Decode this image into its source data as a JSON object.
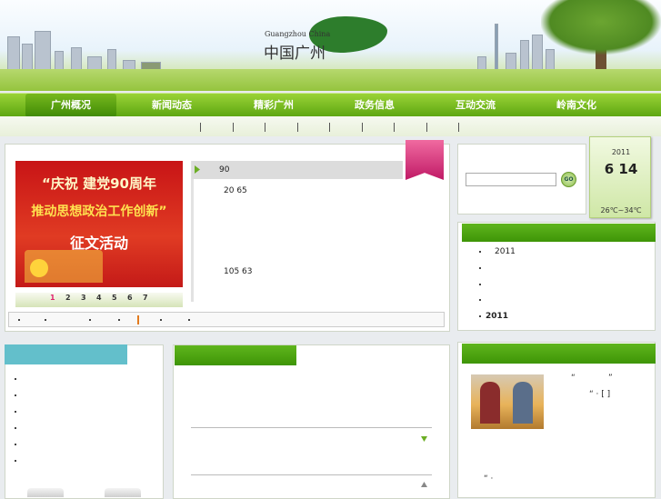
{
  "header": {
    "brand_en": "Guangzhou China",
    "brand_cn": "中国广州"
  },
  "nav": {
    "items": [
      "广州概况",
      "新闻动态",
      "精彩广州",
      "政务信息",
      "互动交流",
      "岭南文化"
    ],
    "active_index": 0
  },
  "banner": {
    "line1": "“庆祝 建党90周年",
    "line2": "推动思想政治工作创新”",
    "line3": "征文活动",
    "pages": [
      "1",
      "2",
      "3",
      "4",
      "5",
      "6",
      "7"
    ],
    "active_page": "1"
  },
  "news": {
    "items": [
      "90",
      "20   65",
      "105 63"
    ]
  },
  "calendar": {
    "year": "2011",
    "date": "6 14",
    "temperature": "26℃~34℃"
  },
  "search": {
    "go_label": "GO"
  },
  "right_list": {
    "items": [
      "2011",
      "",
      "",
      "",
      "2011"
    ]
  },
  "right_feature": {
    "quote_open": "“",
    "quote_close": "”",
    "line2": "“   ·   [ ]",
    "footer": "“   ·"
  },
  "colors": {
    "nav_green": "#5ea711",
    "accent_pink": "#e23a84",
    "teal": "#63bfcb"
  }
}
